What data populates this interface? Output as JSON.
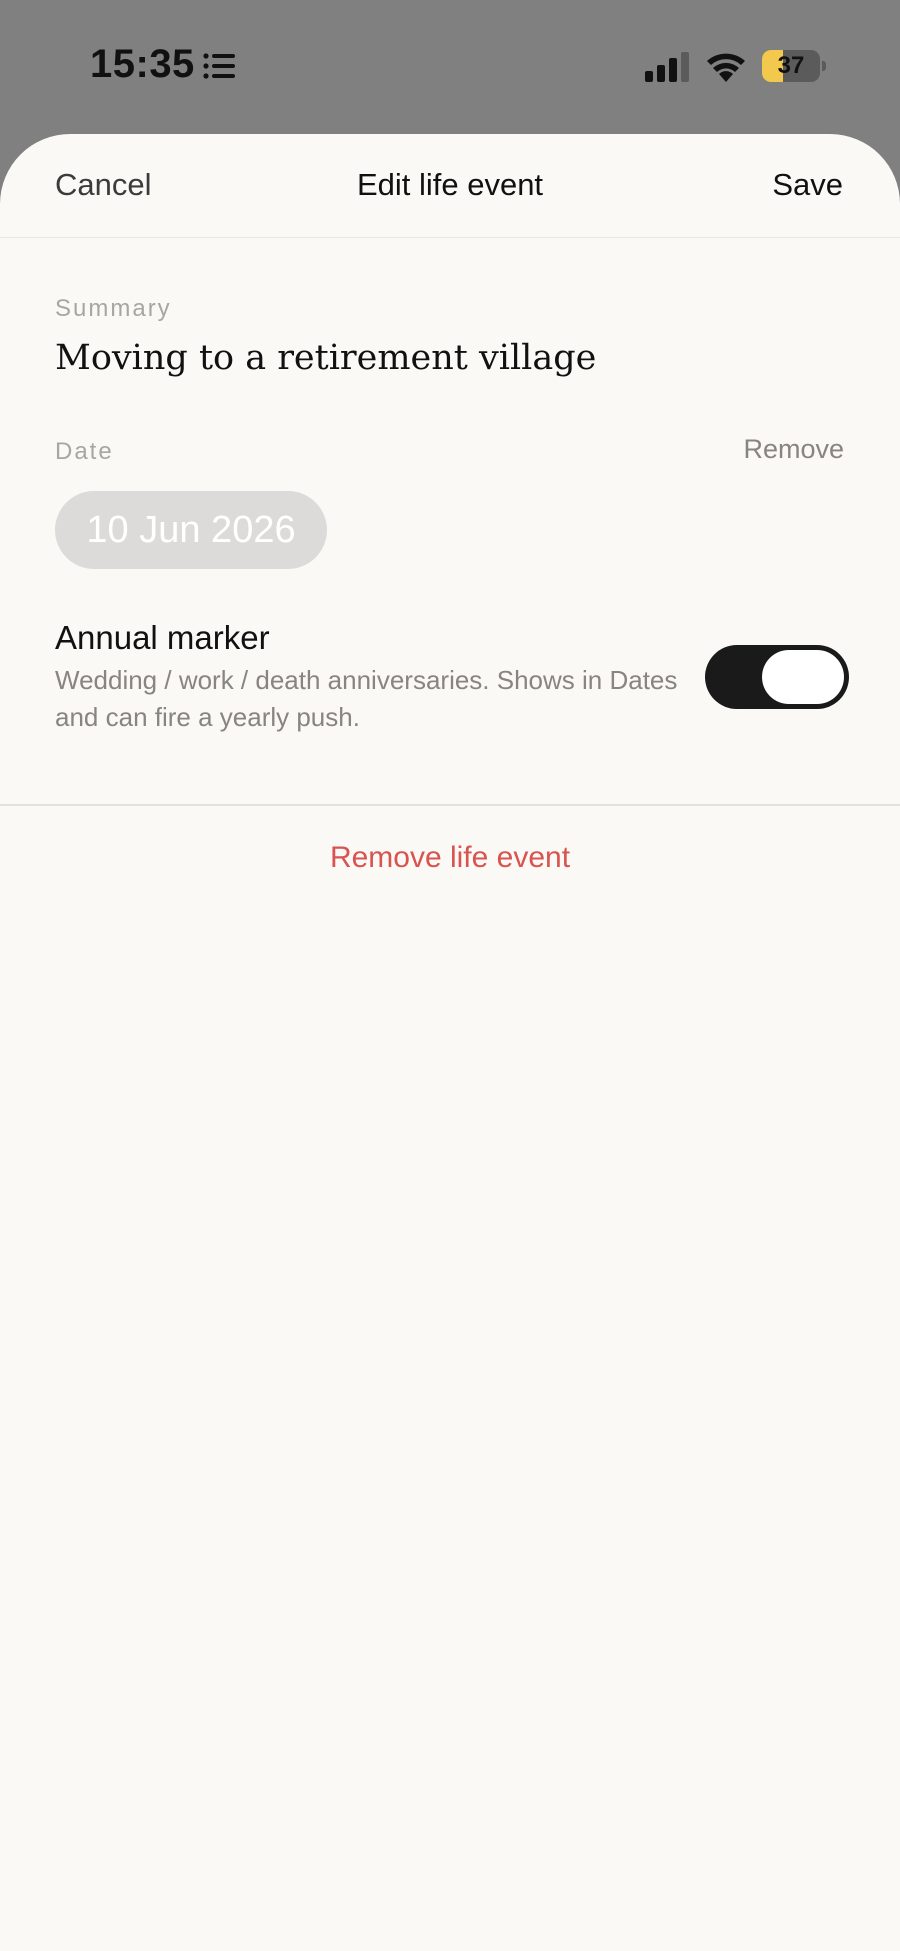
{
  "status_bar": {
    "time": "15:35",
    "battery_percent": "37",
    "battery_level": 0.37,
    "icons": [
      "list-icon",
      "signal-icon",
      "wifi-icon",
      "battery-icon"
    ]
  },
  "nav": {
    "cancel_label": "Cancel",
    "title": "Edit life event",
    "save_label": "Save"
  },
  "summary": {
    "label": "Summary",
    "value": "Moving to a retirement village"
  },
  "date": {
    "label": "Date",
    "remove_label": "Remove",
    "value": "10 Jun 2026"
  },
  "annual_marker": {
    "title": "Annual marker",
    "description": "Wedding / work / death anniversaries. Shows in Dates and can fire a yearly push.",
    "enabled": true
  },
  "remove_event_label": "Remove life event",
  "colors": {
    "backdrop": "#808080",
    "sheet_background": "#faf9f6",
    "destructive": "#d9534f",
    "toggle_on": "#1a1a1a",
    "battery_fill": "#f2c94c"
  }
}
